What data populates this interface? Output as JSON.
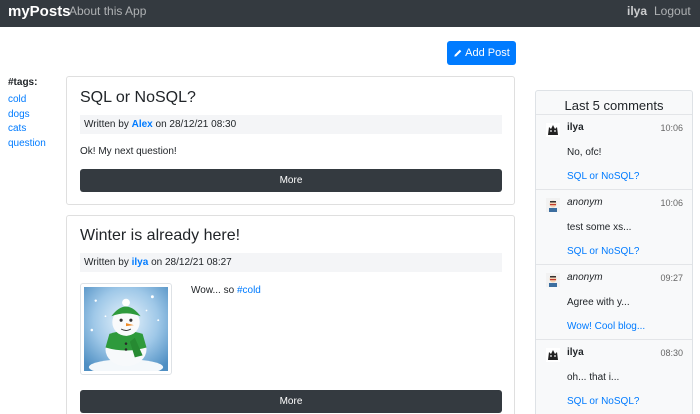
{
  "navbar": {
    "brand": "myPosts",
    "about": "About this App",
    "user": "ilya",
    "logout": "Logout"
  },
  "actions": {
    "add_post": "Add Post"
  },
  "tags": {
    "title": "#tags:",
    "items": [
      "cold",
      "dogs",
      "cats",
      "question"
    ]
  },
  "posts": [
    {
      "title": "SQL or NoSQL?",
      "written_by": "Written by",
      "author": "Alex",
      "on": "on 28/12/21 08:30",
      "body": "Ok! My next question!",
      "more": "More"
    },
    {
      "title": "Winter is already here!",
      "written_by": "Written by",
      "author": "ilya",
      "on": "on 28/12/21 08:27",
      "body": "Wow... so",
      "hashtag": "#cold",
      "more": "More"
    }
  ],
  "comments": {
    "title": "Last 5 comments",
    "items": [
      {
        "author": "ilya",
        "time": "10:06",
        "text": "No, ofc!",
        "post": "SQL or NoSQL?",
        "avatar": "cat-icon"
      },
      {
        "author": "anonym",
        "time": "10:06",
        "text": "test some xs...",
        "post": "SQL or NoSQL?",
        "avatar": "anonymous-icon"
      },
      {
        "author": "anonym",
        "time": "09:27",
        "text": "Agree with y...",
        "post": "Wow! Cool blog...",
        "avatar": "anonymous-icon"
      },
      {
        "author": "ilya",
        "time": "08:30",
        "text": "oh... that i...",
        "post": "SQL or NoSQL?",
        "avatar": "cat-icon"
      }
    ]
  },
  "colors": {
    "navbar": "#343a40",
    "primary": "#007bff",
    "dark_button": "#343a40"
  }
}
